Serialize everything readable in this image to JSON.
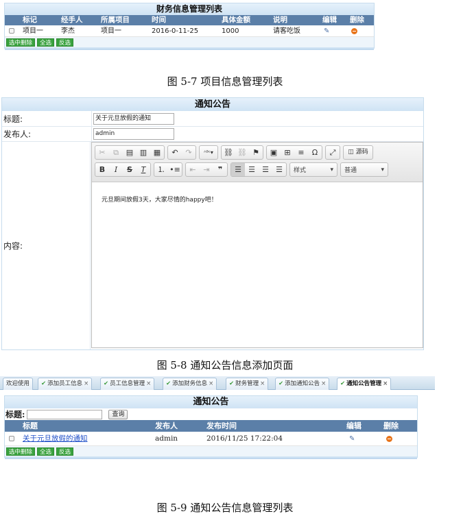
{
  "finance": {
    "title": "财务信息管理列表",
    "columns": [
      "标记",
      "经手人",
      "所属项目",
      "时间",
      "具体金额",
      "说明",
      "编辑",
      "删除"
    ],
    "rows": [
      {
        "mark": "项目一",
        "handler": "李杰",
        "project": "项目一",
        "time": "2016-0-11-25",
        "amount": "1000",
        "note": "请客吃饭"
      }
    ],
    "buttons": [
      "选中删除",
      "全选",
      "反选"
    ]
  },
  "captions": {
    "fig7": "图 5-7 项目信息管理列表",
    "fig8": "图 5-8 通知公告信息添加页面",
    "fig9": "图 5-9 通知公告信息管理列表"
  },
  "notice_form": {
    "title": "通知公告",
    "title_label": "标题:",
    "title_value": "关于元旦放假的通知",
    "publisher_label": "发布人:",
    "publisher_value": "admin",
    "content_label": "内容:",
    "content_text": "元旦期间放假3天，大家尽情的happy吧！",
    "source_label": "源码",
    "style_select": "样式",
    "format_select": "普通"
  },
  "tabs": [
    {
      "label": "欢迎使用",
      "check": false,
      "close": false
    },
    {
      "label": "添加员工信息",
      "check": true,
      "close": true
    },
    {
      "label": "员工信息管理",
      "check": true,
      "close": true
    },
    {
      "label": "添加财务信息",
      "check": true,
      "close": true
    },
    {
      "label": "财务管理",
      "check": true,
      "close": true
    },
    {
      "label": "添加通知公告",
      "check": true,
      "close": true
    },
    {
      "label": "通知公告管理",
      "check": true,
      "close": true,
      "active": true
    }
  ],
  "notice_list": {
    "title": "通知公告",
    "search_label": "标题:",
    "search_value": "",
    "search_button": "查询",
    "columns": [
      "标题",
      "发布人",
      "发布时间",
      "编辑",
      "删除"
    ],
    "rows": [
      {
        "title": "关于元旦放假的通知",
        "publisher": "admin",
        "time": "2016/11/25 17:22:04"
      }
    ],
    "buttons": [
      "选中删除",
      "全选",
      "反选"
    ]
  },
  "colors": {
    "header_blue": "#5b7fa8",
    "button_green": "#3aa23f",
    "delete_orange": "#e8741a"
  }
}
